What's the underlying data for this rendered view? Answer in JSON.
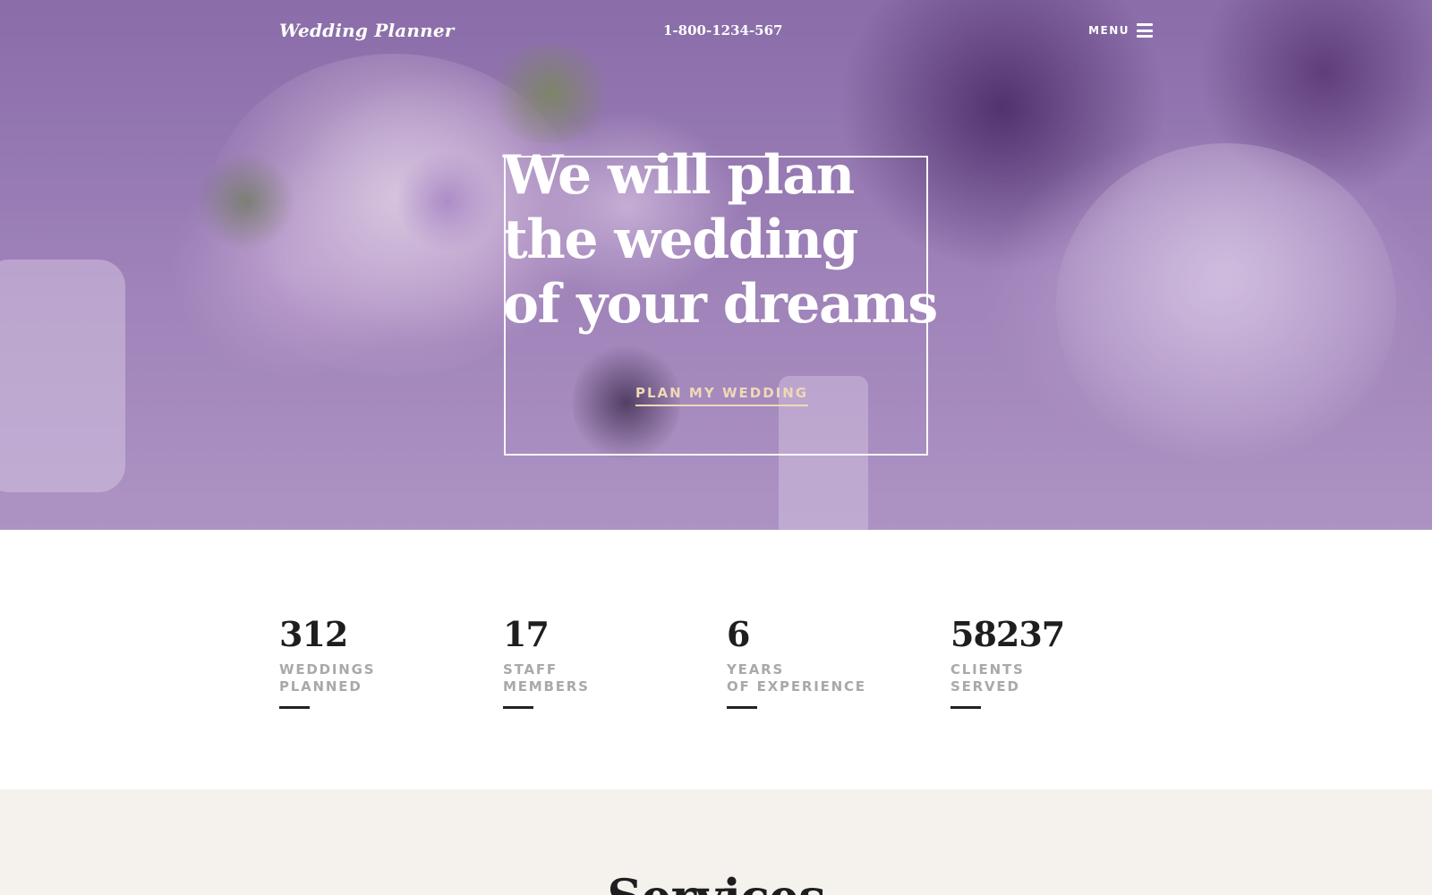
{
  "header": {
    "logo": "Wedding Planner",
    "phone": "1-800-1234-567",
    "menu_label": "MENU"
  },
  "hero": {
    "headline_lines": [
      "We will plan",
      "the wedding",
      "of your dreams"
    ],
    "cta_label": "PLAN MY WEDDING"
  },
  "stats": [
    {
      "number": "312",
      "label_line1": "WEDDINGS",
      "label_line2": "PLANNED"
    },
    {
      "number": "17",
      "label_line1": "STAFF",
      "label_line2": "MEMBERS"
    },
    {
      "number": "6",
      "label_line1": "YEARS",
      "label_line2": "OF EXPERIENCE"
    },
    {
      "number": "58237",
      "label_line1": "CLIENTS",
      "label_line2": "SERVED"
    }
  ],
  "services": {
    "title": "Services"
  },
  "colors": {
    "hero_overlay": "#8e74ab",
    "cta_accent": "#f0d8b8",
    "stat_label": "#a9a9a9",
    "services_bg": "#f5f2ee"
  },
  "icons": {
    "menu": "hamburger-icon"
  }
}
